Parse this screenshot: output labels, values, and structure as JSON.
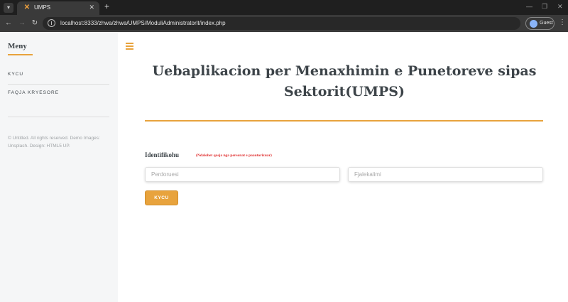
{
  "browser": {
    "tab_title": "UMPS",
    "url": "localhost:8333/zhwa/zhwa/UMPS/ModuliAdministratorit/index.php",
    "profile_label": "Guest"
  },
  "sidebar": {
    "title": "Meny",
    "items": [
      {
        "label": "KYCU"
      },
      {
        "label": "FAQJA KRYESORE"
      }
    ],
    "footer": "© Untitled. All rights reserved. Demo Images: Unsplash. Design: HTML5 UP."
  },
  "main": {
    "title": "Uebaplikacion per Menaxhimin e Punetoreve sipas Sektorit(UMPS)",
    "identification_label": "Identifikohu",
    "identification_note": "(Ndalohet qasja nga personat e paautorizuar)",
    "username_placeholder": "Perdoruesi",
    "password_placeholder": "Fjalekalimi",
    "login_button": "KYCU"
  },
  "colors": {
    "accent": "#e8a33d",
    "warning_text": "#e03131",
    "sidebar_bg": "#f5f6f7",
    "heading_text": "#3d4449"
  }
}
